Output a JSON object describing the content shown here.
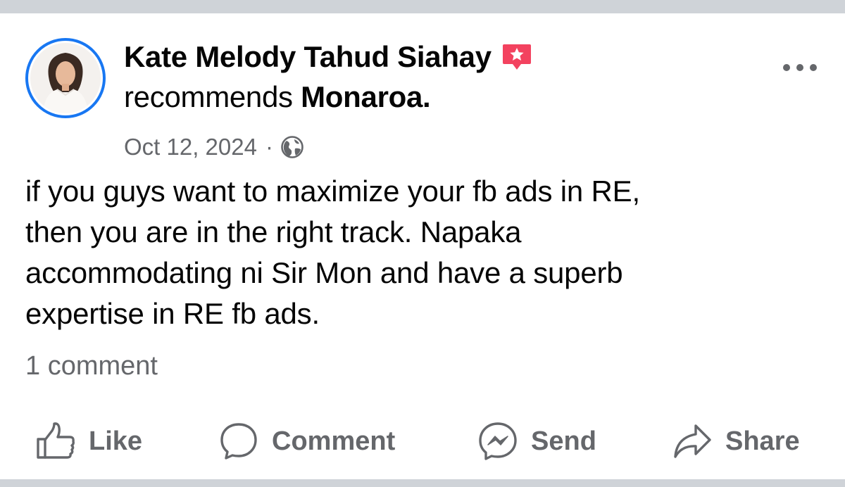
{
  "post": {
    "author_name": "Kate Melody Tahud Siahay",
    "recommends_prefix": "recommends",
    "page_name": "Monaroa.",
    "date": "Oct 12, 2024",
    "dot": "·",
    "body": "if you guys want to maximize your fb ads in RE,\nthen you are in the right track. Napaka\naccommodating ni Sir Mon and have a superb\nexpertise in RE fb ads.",
    "comment_count": "1 comment"
  },
  "actions": {
    "like_label": "Like",
    "comment_label": "Comment",
    "send_label": "Send",
    "share_label": "Share"
  },
  "icons": {
    "badge": "recommendation-star-icon",
    "privacy": "globe-icon",
    "more": "more-options-icon",
    "like": "thumbs-up-icon",
    "comment": "comment-bubble-icon",
    "send": "messenger-icon",
    "share": "share-arrow-icon"
  },
  "colors": {
    "card_background": "#ffffff",
    "page_background": "#cfd3d8",
    "avatar_ring": "#1877f2",
    "recommend_badge": "#f3425f",
    "secondary_text": "#65676b",
    "primary_text": "#050505"
  }
}
